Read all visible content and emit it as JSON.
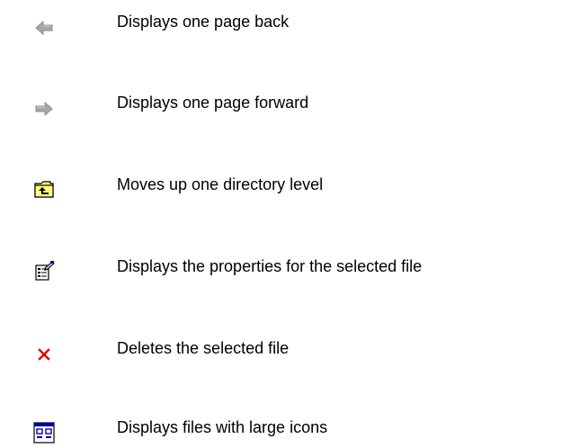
{
  "legend": {
    "items": [
      {
        "icon": "back-arrow-icon",
        "description": "Displays one page back"
      },
      {
        "icon": "forward-arrow-icon",
        "description": "Displays one page forward"
      },
      {
        "icon": "folder-up-icon",
        "description": "Moves up one directory level"
      },
      {
        "icon": "properties-icon",
        "description": "Displays the properties for the selected file"
      },
      {
        "icon": "delete-icon",
        "description": "Deletes the selected file"
      },
      {
        "icon": "large-icons-view-icon",
        "description": "Displays files with large icons"
      }
    ]
  },
  "colors": {
    "arrow_gray": "#a0a0a0",
    "folder_yellow": "#ffff80",
    "delete_red": "#e00000",
    "view_blue": "#0000a0"
  }
}
